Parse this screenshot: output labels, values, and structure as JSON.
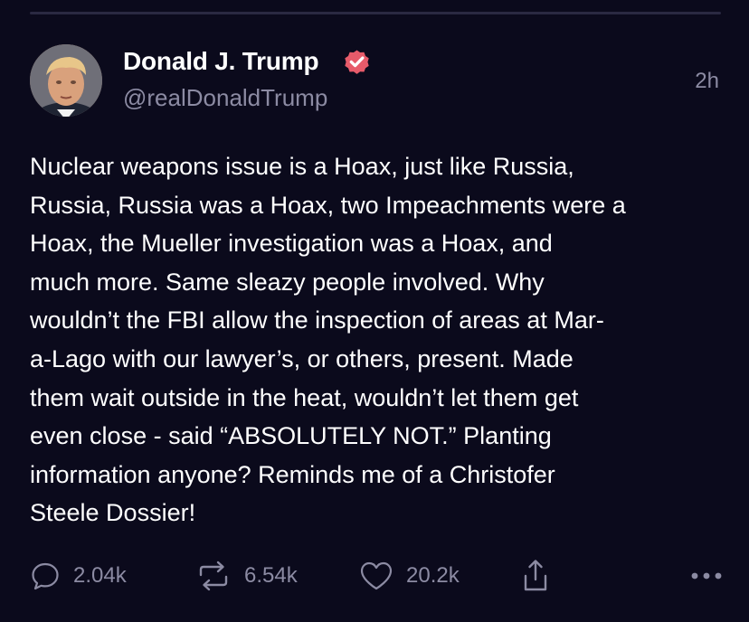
{
  "post": {
    "author": {
      "display_name": "Donald J. Trump",
      "handle": "@realDonaldTrump",
      "verified": true,
      "verified_color": "#e75b6a",
      "avatar_icon": "profile-photo"
    },
    "timestamp": "2h",
    "body": "Nuclear weapons issue is a Hoax, just like Russia,\nRussia, Russia was a Hoax, two Impeachments were a\nHoax, the Mueller investigation was a Hoax, and\nmuch more. Same sleazy people involved. Why\nwouldn’t the FBI allow the inspection of areas at Mar-\na-Lago with our lawyer’s, or others, present. Made\nthem wait outside in the heat, wouldn’t let them get\neven close - said “ABSOLUTELY NOT.” Planting\ninformation anyone? Reminds me of a Christofer\nSteele Dossier!"
  },
  "actions": {
    "reply": {
      "icon": "comment-icon",
      "count": "2.04k"
    },
    "repost": {
      "icon": "repost-icon",
      "count": "6.54k"
    },
    "like": {
      "icon": "heart-icon",
      "count": "20.2k"
    },
    "share": {
      "icon": "share-icon"
    },
    "more": {
      "icon": "more-icon"
    }
  },
  "colors": {
    "background": "#0b0a1c",
    "text": "#ffffff",
    "muted": "#8c8ba3",
    "divider": "#2a2942"
  }
}
